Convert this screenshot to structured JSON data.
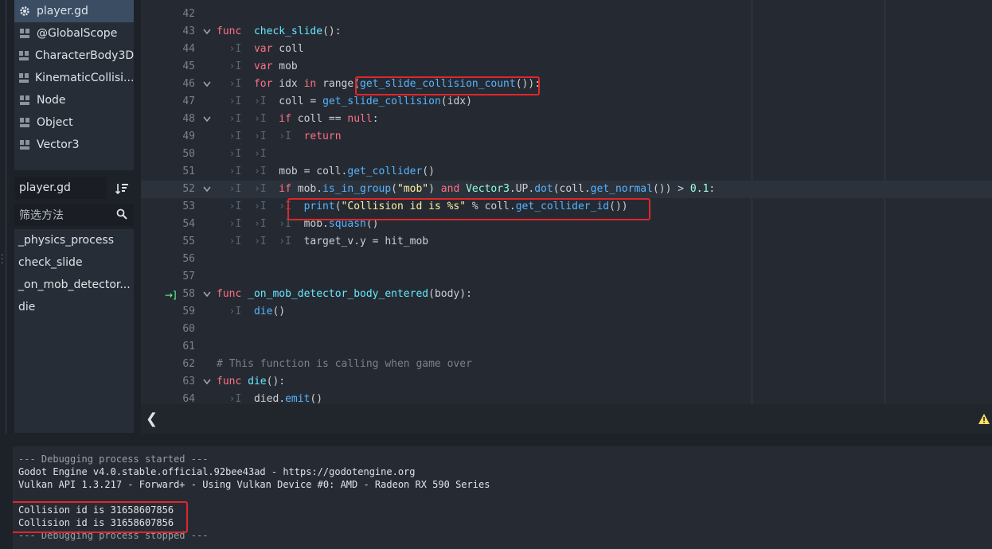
{
  "sidebar": {
    "scripts": [
      {
        "label": "player.gd",
        "icon": "gear-icon",
        "selected": true
      },
      {
        "label": "@GlobalScope",
        "icon": "doc-icon",
        "selected": false
      },
      {
        "label": "CharacterBody3D",
        "icon": "doc-icon",
        "selected": false
      },
      {
        "label": "KinematicCollisi...",
        "icon": "doc-icon",
        "selected": false
      },
      {
        "label": "Node",
        "icon": "doc-icon",
        "selected": false
      },
      {
        "label": "Object",
        "icon": "doc-icon",
        "selected": false
      },
      {
        "label": "Vector3",
        "icon": "doc-icon",
        "selected": false
      }
    ],
    "file_name": "player.gd",
    "filter_placeholder": "筛选方法",
    "methods": [
      "_physics_process",
      "check_slide",
      "_on_mob_detector...",
      "die"
    ]
  },
  "editor": {
    "lines": [
      {
        "n": "42"
      },
      {
        "n": "43"
      },
      {
        "n": "44"
      },
      {
        "n": "45"
      },
      {
        "n": "46"
      },
      {
        "n": "47"
      },
      {
        "n": "48"
      },
      {
        "n": "49"
      },
      {
        "n": "50"
      },
      {
        "n": "51"
      },
      {
        "n": "52"
      },
      {
        "n": "53"
      },
      {
        "n": "54"
      },
      {
        "n": "55"
      },
      {
        "n": "56"
      },
      {
        "n": "57"
      },
      {
        "n": "58"
      },
      {
        "n": "59"
      },
      {
        "n": "60"
      },
      {
        "n": "61"
      },
      {
        "n": "62"
      },
      {
        "n": "63"
      },
      {
        "n": "64"
      }
    ],
    "code": {
      "l43": [
        "func",
        "check_slide",
        "():"
      ],
      "l44": [
        "var",
        " coll"
      ],
      "l45": [
        "var",
        " mob"
      ],
      "l46": [
        "for",
        " idx ",
        "in",
        " range(",
        "get_slide_collision_count",
        "()):"
      ],
      "l47": [
        "coll = ",
        "get_slide_collision",
        "(idx)"
      ],
      "l48": [
        "if",
        " coll == ",
        "null",
        ":"
      ],
      "l49": [
        "return"
      ],
      "l51": [
        "mob = coll.",
        "get_collider",
        "()"
      ],
      "l52": [
        "if",
        " mob.",
        "is_in_group",
        "(",
        "\"mob\"",
        ") ",
        "and",
        " ",
        "Vector3",
        ".UP.",
        "dot",
        "(coll.",
        "get_normal",
        "()) > ",
        "0.1",
        ":"
      ],
      "l53": [
        "print",
        "(",
        "\"Collision id is %s\"",
        " % coll.",
        "get_collider_id",
        "())"
      ],
      "l54": [
        "mob.",
        "squash",
        "()"
      ],
      "l55": [
        "target_v.y = hit_mob"
      ],
      "l58": [
        "func",
        " _on_mob_detector_body_entered",
        "(body):"
      ],
      "l59": [
        "die",
        "()"
      ],
      "l62": [
        "# This function is calling when game over"
      ],
      "l63": [
        "func",
        " die",
        "():"
      ],
      "l64": [
        "died.",
        "emit",
        "()"
      ]
    }
  },
  "output": {
    "lines": [
      "--- Debugging process started ---",
      "Godot Engine v4.0.stable.official.92bee43ad - https://godotengine.org",
      "Vulkan API 1.3.217 - Forward+ - Using Vulkan Device #0: AMD - Radeon RX 590 Series",
      "Collision id is 31658607856",
      "Collision id is 31658607856",
      "--- Debugging process stopped ---"
    ]
  },
  "colors": {
    "highlight_box": "#e0262b",
    "selected_row": "#3a4d63",
    "keyword": "#ff7085",
    "function": "#57b3ff",
    "string": "#ffeda1"
  }
}
